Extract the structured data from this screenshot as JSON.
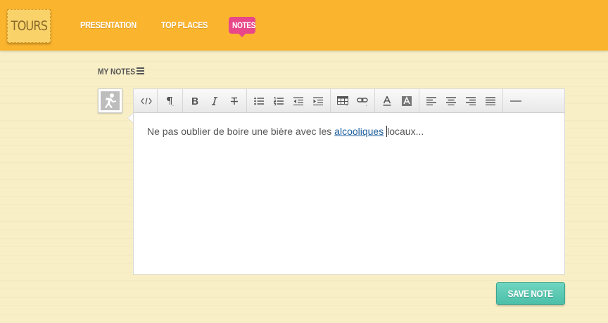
{
  "header": {
    "logo": "TOURS",
    "nav": [
      "PRESENTATION",
      "TOP PLACES",
      "NOTES"
    ],
    "active_nav": "NOTES"
  },
  "notes": {
    "title": "MY NOTES",
    "text_before_link": "Ne pas oublier de boire une bière avec les ",
    "link": "alcooliques",
    "text_after_link": "locaux..."
  },
  "toolbar": {
    "icons": [
      "code-icon",
      "paragraph-icon",
      "bold-icon",
      "italic-icon",
      "strikethrough-icon",
      "unordered-list-icon",
      "ordered-list-icon",
      "outdent-icon",
      "indent-icon",
      "table-icon",
      "link-icon",
      "font-color-icon",
      "background-color-icon",
      "align-left-icon",
      "align-center-icon",
      "align-right-icon",
      "justify-icon",
      "horizontal-rule-icon"
    ]
  },
  "actions": {
    "save_label": "SAVE NOTE"
  },
  "colors": {
    "header": "#fbb42e",
    "active_nav": "#e8488a",
    "save_button": "#5cc9b2",
    "background": "#f8efc7"
  }
}
